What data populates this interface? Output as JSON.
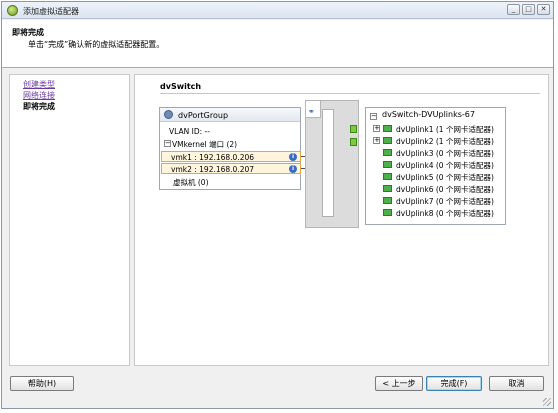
{
  "window": {
    "title": "添加虚拟适配器"
  },
  "header": {
    "title": "即将完成",
    "subtitle": "单击“完成”确认新的虚拟适配器配置。"
  },
  "nav": {
    "items": [
      {
        "label": "创建类型",
        "state": "link"
      },
      {
        "label": "网络连接",
        "state": "link"
      },
      {
        "label": "即将完成",
        "state": "current"
      }
    ]
  },
  "main": {
    "section_title": "dvSwitch",
    "port_group": {
      "name": "dvPortGroup",
      "vlan": "VLAN ID: --",
      "vmkernel_label": "VMkernel 端口 (2)",
      "vmk": [
        {
          "label": "vmk1 : 192.168.0.206"
        },
        {
          "label": "vmk2 : 192.168.0.207"
        }
      ],
      "vm_label": "虚拟机 (0)"
    },
    "uplinks": {
      "name": "dvSwitch-DVUplinks-67",
      "items": [
        {
          "label": "dvUplink1 (1 个网卡适配器)",
          "expandable": true
        },
        {
          "label": "dvUplink2 (1 个网卡适配器)",
          "expandable": true
        },
        {
          "label": "dvUplink3 (0 个网卡适配器)",
          "expandable": false
        },
        {
          "label": "dvUplink4 (0 个网卡适配器)",
          "expandable": false
        },
        {
          "label": "dvUplink5 (0 个网卡适配器)",
          "expandable": false
        },
        {
          "label": "dvUplink6 (0 个网卡适配器)",
          "expandable": false
        },
        {
          "label": "dvUplink7 (0 个网卡适配器)",
          "expandable": false
        },
        {
          "label": "dvUplink8 (0 个网卡适配器)",
          "expandable": false
        }
      ]
    }
  },
  "footer": {
    "help": "帮助(H)",
    "back": "< 上一步",
    "finish": "完成(F)",
    "cancel": "取消"
  },
  "colors": {
    "accent_link": "#6a3aa0",
    "highlight_row": "#fff4dc",
    "highlight_border": "#e5a640",
    "nic_green": "#4db04a"
  }
}
